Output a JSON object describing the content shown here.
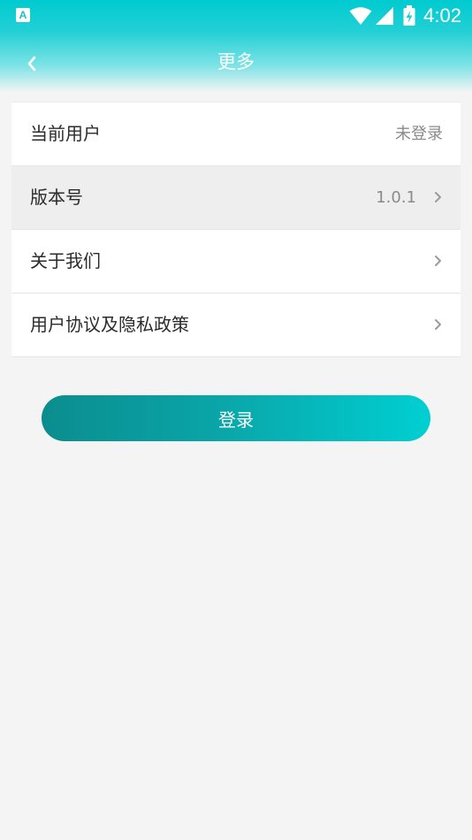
{
  "status_bar": {
    "app_icon_letter": "A",
    "time": "4:02",
    "icons": [
      "wifi-icon",
      "signal-icon",
      "battery-charging-icon"
    ]
  },
  "header": {
    "title": "更多",
    "back_icon": "chevron-left-icon"
  },
  "settings": {
    "items": [
      {
        "label": "当前用户",
        "value": "未登录",
        "has_arrow": false
      },
      {
        "label": "版本号",
        "value": "1.0.1",
        "has_arrow": true
      },
      {
        "label": "关于我们",
        "value": "",
        "has_arrow": true
      },
      {
        "label": "用户协议及隐私政策",
        "value": "",
        "has_arrow": true
      }
    ]
  },
  "login_button": {
    "label": "登录"
  },
  "colors": {
    "accent": "#00cbd0",
    "button_start": "#0b8d8f",
    "button_end": "#00cfd2",
    "background": "#f4f4f4"
  }
}
